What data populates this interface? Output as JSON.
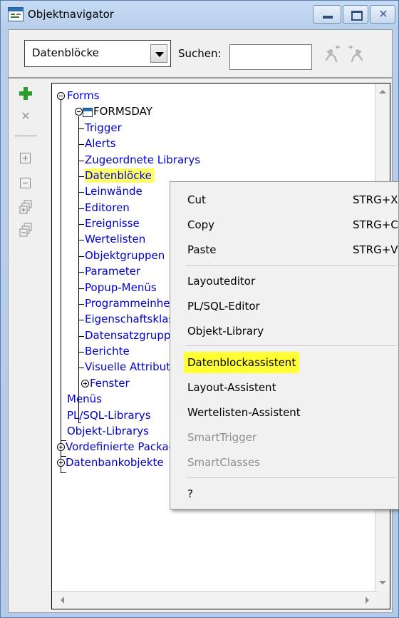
{
  "window": {
    "title": "Objektnavigator",
    "close_glyph": "✕"
  },
  "toolbar": {
    "view_select": "Datenblöcke",
    "search_label": "Suchen:",
    "search_value": "",
    "icons": [
      "find-previous-icon",
      "find-next-icon"
    ]
  },
  "side_tools": {
    "icons": [
      "add-icon",
      "delete-icon",
      "expand-icon",
      "collapse-icon",
      "expand-all-icon",
      "collapse-all-icon"
    ],
    "delete_glyph": "✕"
  },
  "tree": {
    "forms": "Forms",
    "module": "FORMSDAY",
    "module_children": [
      "Trigger",
      "Alerts",
      "Zugeordnete Librarys",
      "Datenblöcke",
      "Leinwände",
      "Editoren",
      "Ereignisse",
      "Wertelisten",
      "Objektgruppen",
      "Parameter",
      "Popup-Menüs",
      "Programmeinheiten",
      "Eigenschaftsklassen",
      "Datensatzgruppen",
      "Berichte",
      "Visuelle Attribute",
      "Fenster"
    ],
    "forms_siblings": [
      "Menüs",
      "PL/SQL-Librarys",
      "Objekt-Librarys"
    ],
    "roots": [
      "Vordefinierte Packages",
      "Datenbankobjekte"
    ],
    "highlight_color": "#ffff66",
    "link_color": "#0000cc"
  },
  "context_menu": {
    "items": [
      {
        "label": "Cut",
        "shortcut": "STRG+X"
      },
      {
        "label": "Copy",
        "shortcut": "STRG+C"
      },
      {
        "label": "Paste",
        "shortcut": "STRG+V"
      },
      {
        "label": "Layouteditor",
        "shortcut": ""
      },
      {
        "label": "PL/SQL-Editor",
        "shortcut": ""
      },
      {
        "label": "Objekt-Library",
        "shortcut": ""
      },
      {
        "label": "Datenblockassistent",
        "shortcut": ""
      },
      {
        "label": "Layout-Assistent",
        "shortcut": ""
      },
      {
        "label": "Wertelisten-Assistent",
        "shortcut": ""
      },
      {
        "label": "SmartTrigger",
        "shortcut": ""
      },
      {
        "label": "SmartClasses",
        "shortcut": ""
      },
      {
        "label": "?",
        "shortcut": ""
      }
    ],
    "highlight_color": "#ffff33"
  }
}
